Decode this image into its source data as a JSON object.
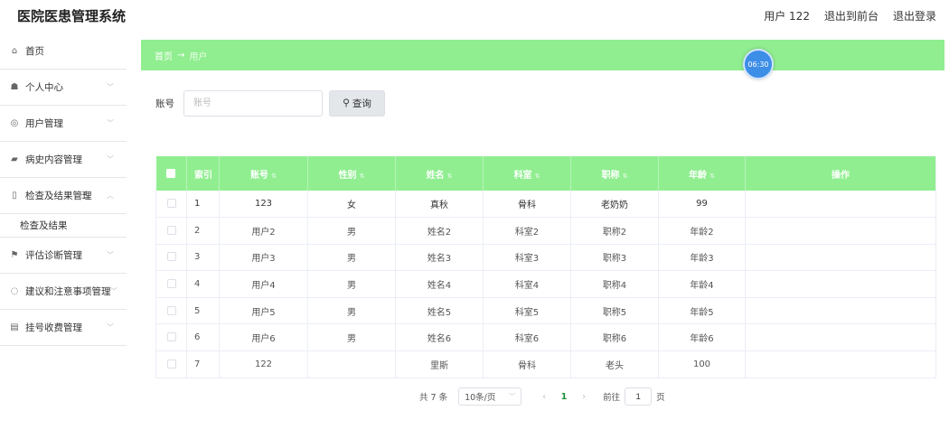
{
  "app": {
    "title": "医院医患管理系统"
  },
  "top_links": {
    "user": "用户 122",
    "to_front": "退出到前台",
    "logout": "退出登录"
  },
  "sidebar": {
    "items": [
      {
        "label": "首页",
        "icon": "home-icon",
        "glyph": "⌂"
      },
      {
        "label": "个人中心",
        "icon": "person-icon",
        "glyph": "☗"
      },
      {
        "label": "用户管理",
        "icon": "user-manage-icon",
        "glyph": "◎"
      },
      {
        "label": "病史内容管理",
        "icon": "thumb-icon",
        "glyph": "▰"
      },
      {
        "label": "检查及结果管理",
        "icon": "document-icon",
        "glyph": "▯"
      },
      {
        "label": "评估诊断管理",
        "icon": "flag-icon",
        "glyph": "⚑"
      },
      {
        "label": "建议和注意事项管理",
        "icon": "circle-icon",
        "glyph": "◌"
      },
      {
        "label": "挂号收费管理",
        "icon": "ticket-icon",
        "glyph": "▤"
      }
    ],
    "sub_item": "检查及结果"
  },
  "breadcrumb": {
    "home": "首页",
    "arrow": "→",
    "current": "用户"
  },
  "timer": "06:30",
  "search": {
    "label": "账号",
    "placeholder": "账号",
    "button": "查询"
  },
  "table": {
    "headers": [
      "索引",
      "账号",
      "性别",
      "姓名",
      "科室",
      "职称",
      "年龄",
      "操作"
    ],
    "rows": [
      [
        "1",
        "123",
        "女",
        "真秋",
        "骨科",
        "老奶奶",
        "99",
        ""
      ],
      [
        "2",
        "用户2",
        "男",
        "姓名2",
        "科室2",
        "职称2",
        "年龄2",
        ""
      ],
      [
        "3",
        "用户3",
        "男",
        "姓名3",
        "科室3",
        "职称3",
        "年龄3",
        ""
      ],
      [
        "4",
        "用户4",
        "男",
        "姓名4",
        "科室4",
        "职称4",
        "年龄4",
        ""
      ],
      [
        "5",
        "用户5",
        "男",
        "姓名5",
        "科室5",
        "职称5",
        "年龄5",
        ""
      ],
      [
        "6",
        "用户6",
        "男",
        "姓名6",
        "科室6",
        "职称6",
        "年龄6",
        ""
      ],
      [
        "7",
        "122",
        "",
        "里斯",
        "骨科",
        "老头",
        "100",
        ""
      ]
    ]
  },
  "pagination": {
    "total": "共 7 条",
    "page_size": "10条/页",
    "current_page": "1",
    "jump_prefix": "前往",
    "jump_value": "1",
    "jump_suffix": "页"
  },
  "colors": {
    "accent": "#90ee90",
    "timer": "#3d8ee6"
  }
}
